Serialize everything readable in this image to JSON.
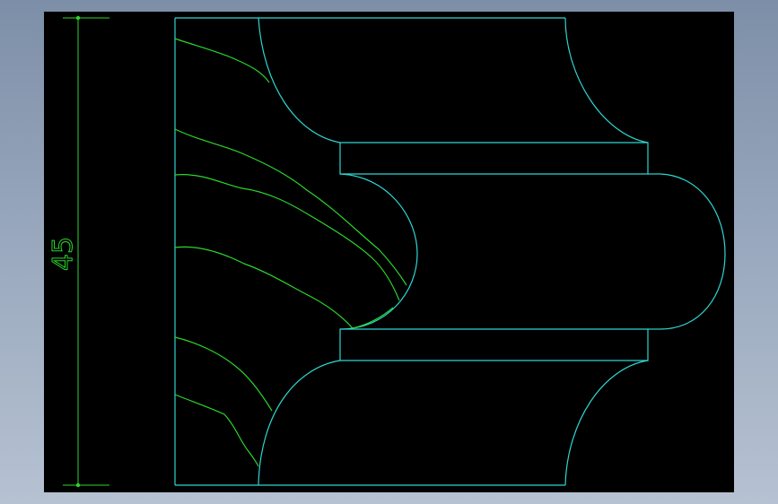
{
  "colors": {
    "background": "#000000",
    "outline": "#2fd6d2",
    "detail": "#2bd62b",
    "dimension": "#2bd62b"
  },
  "dimension": {
    "value": "45",
    "orientation": "vertical"
  }
}
